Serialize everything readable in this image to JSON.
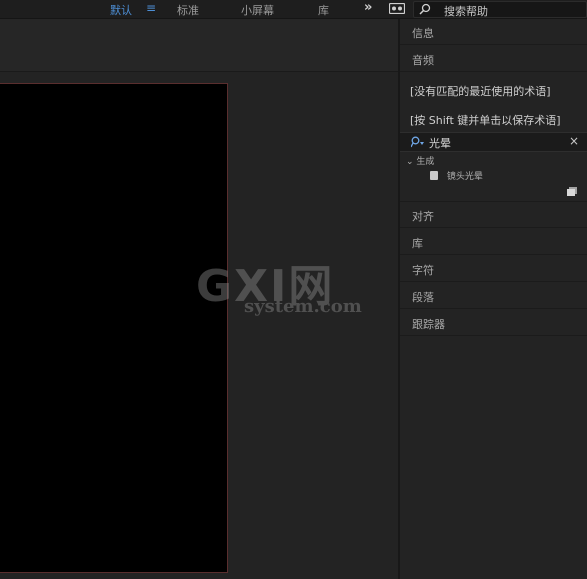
{
  "workspaces": {
    "tabs": [
      {
        "label": "默认",
        "active": true
      },
      {
        "label": "标准"
      },
      {
        "label": "小屏幕"
      },
      {
        "label": "库"
      }
    ],
    "menu_icon": "≡",
    "more": "»"
  },
  "help": {
    "placeholder": "搜索帮助"
  },
  "panels": {
    "info": "信息",
    "audio": "音频",
    "align": "对齐",
    "libraries": "库",
    "character": "字符",
    "paragraph": "段落",
    "tracker": "跟踪器"
  },
  "effects_presets": {
    "no_recent_hint": "[没有匹配的最近使用的术语]",
    "save_hint": "[按 Shift 键并单击以保存术语]",
    "search_value": "光晕",
    "clear_icon": "×",
    "category": "生成",
    "category_chevron": "⌄",
    "result": "镜头光晕"
  },
  "watermark": {
    "brand": "GXI网",
    "domain": "system.com"
  },
  "colors": {
    "accent": "#4d8fd6",
    "background": "#232323",
    "canvas": "#000000",
    "canvas_border": "#5a2e2e"
  }
}
